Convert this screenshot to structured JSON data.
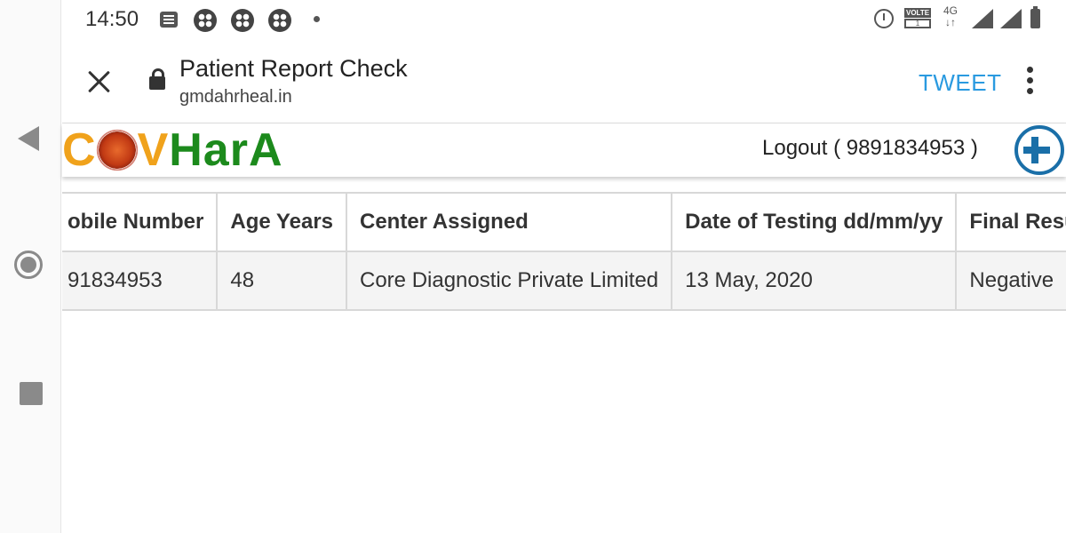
{
  "status_bar": {
    "time": "14:50",
    "network": "4G",
    "volte": "VOLTE"
  },
  "toolbar": {
    "title": "Patient Report Check",
    "url": "gmdahrheal.in",
    "tweet_label": "TWEET"
  },
  "header": {
    "logo_prefix": "C",
    "logo_v": "V",
    "logo_rest": "HarA",
    "logout_label": "Logout ( 9891834953 )"
  },
  "table": {
    "headers": [
      "obile Number",
      "Age Years",
      "Center Assigned",
      "Date of Testing dd/mm/yy",
      "Final Resu"
    ],
    "rows": [
      [
        "91834953",
        "48",
        "Core Diagnostic Private Limited",
        "13 May, 2020",
        "Negative"
      ]
    ]
  },
  "colors": {
    "accent": "#2a9ae0",
    "logo_orange": "#f0a21b",
    "logo_green": "#1c8a1c"
  }
}
